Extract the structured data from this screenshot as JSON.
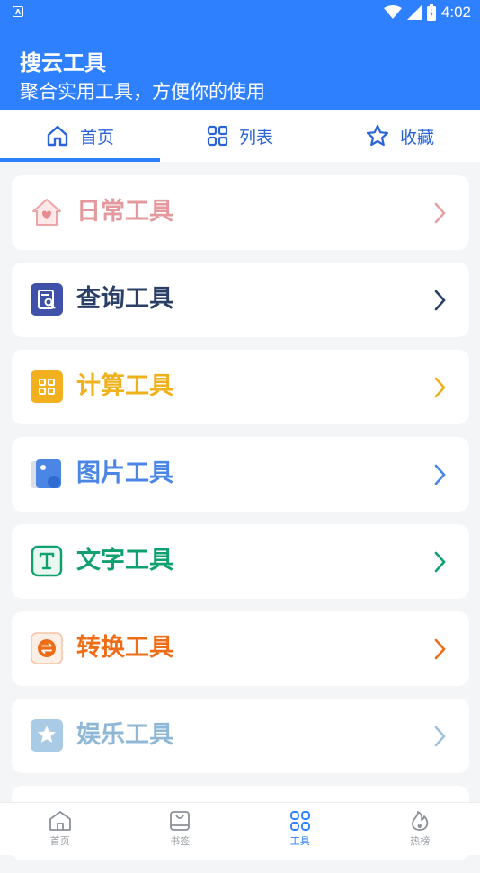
{
  "status_bar": {
    "time": "4:02",
    "notification_icon_letter": "A"
  },
  "header": {
    "title": "搜云工具",
    "subtitle": "聚合实用工具，方便你的使用"
  },
  "tabs": [
    {
      "label": "首页",
      "icon": "home-icon",
      "active": true
    },
    {
      "label": "列表",
      "icon": "grid-icon",
      "active": false
    },
    {
      "label": "收藏",
      "icon": "star-icon",
      "active": false
    }
  ],
  "categories": [
    {
      "label": "日常工具",
      "icon": "house-heart-icon",
      "color": "#e3999d"
    },
    {
      "label": "查询工具",
      "icon": "search-document-icon",
      "color": "#2b3f66"
    },
    {
      "label": "计算工具",
      "icon": "calculator-icon",
      "color": "#efb21d"
    },
    {
      "label": "图片工具",
      "icon": "image-icon",
      "color": "#4b86e4"
    },
    {
      "label": "文字工具",
      "icon": "text-icon",
      "color": "#10a070"
    },
    {
      "label": "转换工具",
      "icon": "convert-icon",
      "color": "#ef6d17"
    },
    {
      "label": "娱乐工具",
      "icon": "star-badge-icon",
      "color": "#8fb7d6"
    }
  ],
  "bottom_nav": [
    {
      "label": "首页",
      "icon": "home-icon",
      "active": false
    },
    {
      "label": "书签",
      "icon": "bookmark-bag-icon",
      "active": false
    },
    {
      "label": "工具",
      "icon": "grid-icon",
      "active": true
    },
    {
      "label": "热榜",
      "icon": "flame-icon",
      "active": false
    }
  ],
  "colors": {
    "primary": "#2f80ff",
    "background": "#f4f5f7"
  }
}
